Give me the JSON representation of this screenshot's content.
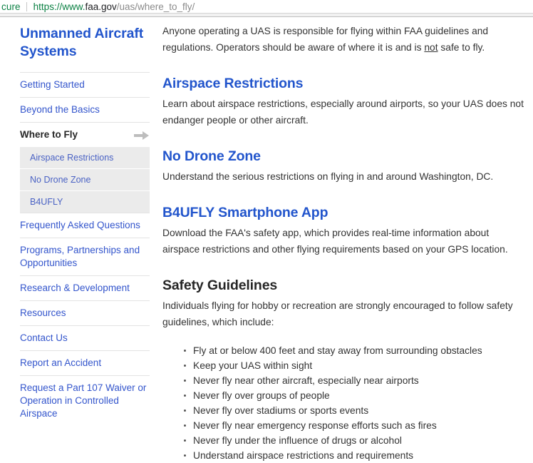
{
  "browser": {
    "security_label_tail": "cure",
    "url_scheme": "https://www.",
    "url_host": "faa.gov",
    "url_path": "/uas/where_to_fly/"
  },
  "sidebar": {
    "title": "Unmanned Aircraft Systems",
    "items": [
      {
        "label": "Getting Started",
        "active": false
      },
      {
        "label": "Beyond the Basics",
        "active": false
      },
      {
        "label": "Where to Fly",
        "active": true,
        "arrow_icon": "arrow-right-icon"
      },
      {
        "label": "Frequently Asked Questions",
        "active": false
      },
      {
        "label": "Programs, Partnerships and Opportunities",
        "active": false
      },
      {
        "label": "Research & Development",
        "active": false
      },
      {
        "label": "Resources",
        "active": false
      },
      {
        "label": "Contact Us",
        "active": false
      },
      {
        "label": "Report an Accident",
        "active": false
      },
      {
        "label": "Request a Part 107 Waiver or Operation in Controlled Airspace",
        "active": false
      }
    ],
    "subnav": [
      {
        "label": "Airspace Restrictions"
      },
      {
        "label": "No Drone Zone"
      },
      {
        "label": "B4UFLY"
      }
    ]
  },
  "main": {
    "intro_part1": "Anyone operating a UAS is responsible for flying within FAA guidelines and regulations. Operators should be aware of where it is and is ",
    "intro_emphasis": "not",
    "intro_part2": " safe to fly.",
    "sections": [
      {
        "heading": "Airspace Restrictions",
        "body": "Learn about airspace restrictions, especially around airports, so your UAS does not endanger people or other aircraft."
      },
      {
        "heading": "No Drone Zone",
        "body": "Understand the serious restrictions on flying in and around Washington, DC."
      },
      {
        "heading": "B4UFLY Smartphone App",
        "body": "Download the FAA's safety app, which provides real-time information about airspace restrictions and other flying requirements based on your GPS location."
      }
    ],
    "safety": {
      "heading": "Safety Guidelines",
      "body": "Individuals flying for hobby or recreation are strongly encouraged to follow safety guidelines, which include:",
      "items": [
        "Fly at or below 400 feet and stay away from surrounding obstacles",
        "Keep your UAS within sight",
        "Never fly near other aircraft, especially near airports",
        "Never fly over groups of people",
        "Never fly over stadiums or sports events",
        "Never fly near emergency response efforts such as fires",
        "Never fly under the influence of drugs or alcohol",
        "Understand airspace restrictions and requirements"
      ]
    }
  },
  "colors": {
    "link_blue": "#3355cc",
    "heading_blue": "#2255cc",
    "secure_green": "#0b8043",
    "subnav_bg": "#ebebeb",
    "body_text": "#333333"
  }
}
